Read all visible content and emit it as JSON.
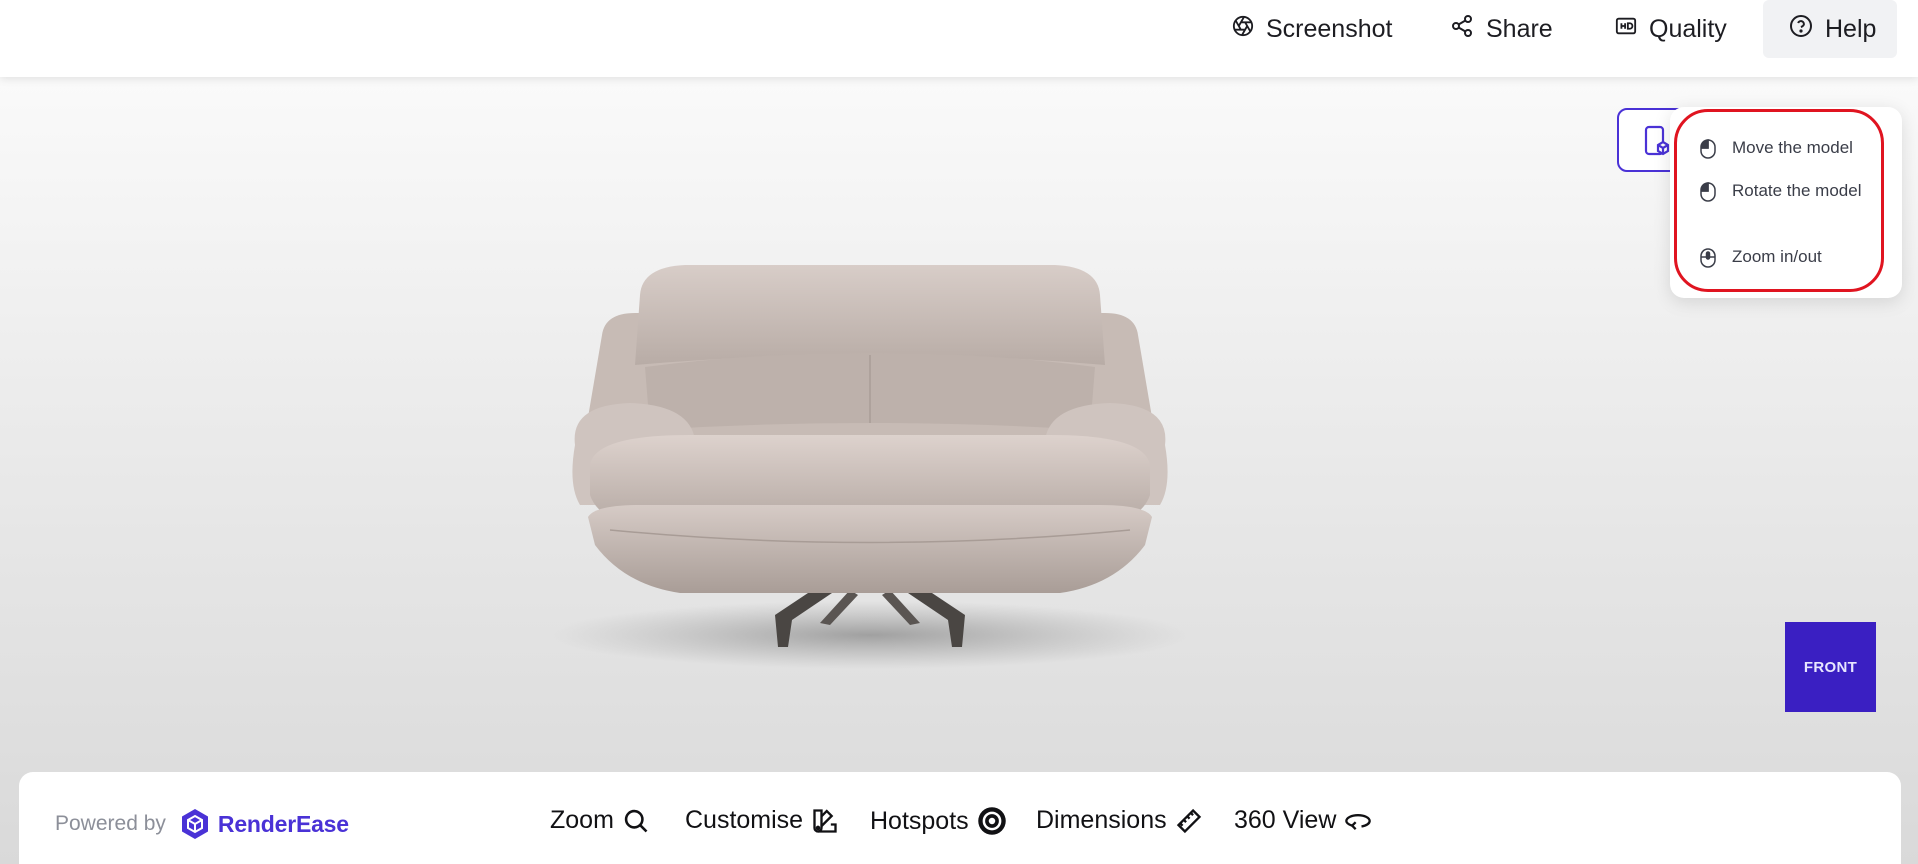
{
  "header": {
    "screenshot_label": "Screenshot",
    "share_label": "Share",
    "quality_label": "Quality",
    "help_label": "Help"
  },
  "help_popover": {
    "items": [
      {
        "label": "Move the model",
        "icon": "mouse-left-click-icon"
      },
      {
        "label": "Rotate the model",
        "icon": "mouse-left-click-icon"
      },
      {
        "label": "Zoom in/out",
        "icon": "mouse-scroll-icon"
      }
    ]
  },
  "viewcube": {
    "face_label": "FRONT",
    "color": "#3a1fc2"
  },
  "footer": {
    "powered_by": "Powered by",
    "brand_name": "RenderEase",
    "brand_color": "#4a32d6",
    "tools": [
      {
        "label": "Zoom",
        "icon": "magnifier-icon"
      },
      {
        "label": "Customise",
        "icon": "swatch-icon"
      },
      {
        "label": "Hotspots",
        "icon": "target-icon"
      },
      {
        "label": "Dimensions",
        "icon": "ruler-icon"
      },
      {
        "label": "360 View",
        "icon": "rotate-360-icon"
      }
    ]
  },
  "colors": {
    "accent": "#4a32d6",
    "highlight_outline": "#e01420"
  }
}
